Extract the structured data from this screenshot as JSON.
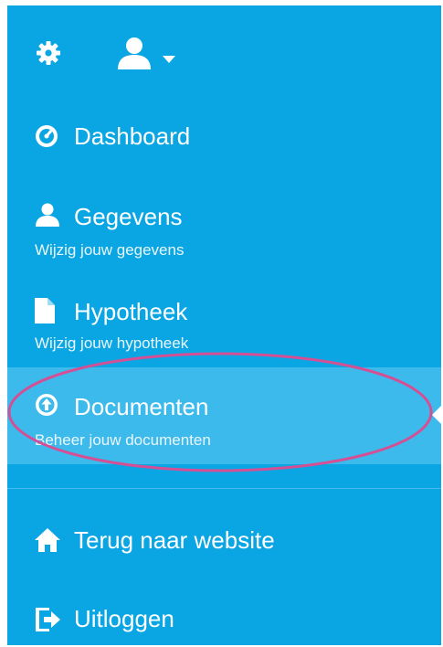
{
  "colors": {
    "sidebar_bg": "#0aa6e3",
    "active_bg": "#3cbaeb",
    "annotation": "#d44f93"
  },
  "topbar": {
    "settings_icon": "gear-icon",
    "user_icon": "user-icon",
    "user_menu_caret": "caret-down-icon"
  },
  "nav": {
    "dashboard": {
      "label": "Dashboard",
      "icon": "dashboard-icon"
    },
    "gegevens": {
      "label": "Gegevens",
      "sub": "Wijzig jouw gegevens",
      "icon": "user-icon"
    },
    "hypotheek": {
      "label": "Hypotheek",
      "sub": "Wijzig jouw hypotheek",
      "icon": "document-icon"
    },
    "documenten": {
      "label": "Documenten",
      "sub": "Beheer jouw documenten",
      "icon": "upload-circle-icon",
      "active": true
    },
    "terug": {
      "label": "Terug naar website",
      "icon": "home-icon"
    },
    "uitloggen": {
      "label": "Uitloggen",
      "icon": "logout-icon"
    }
  }
}
